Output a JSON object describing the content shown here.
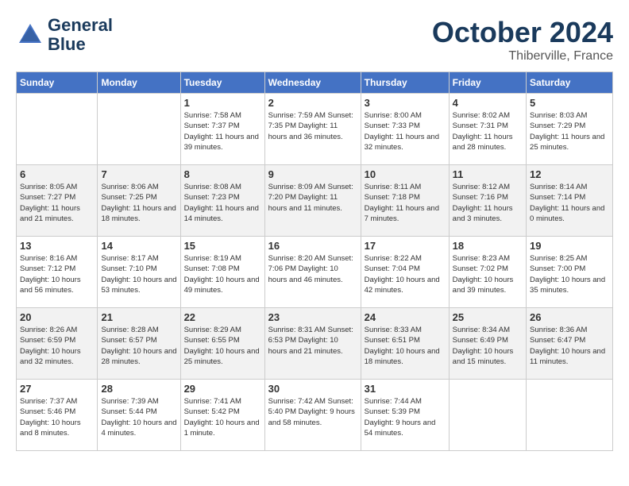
{
  "header": {
    "logo_line1": "General",
    "logo_line2": "Blue",
    "month": "October 2024",
    "location": "Thiberville, France"
  },
  "weekdays": [
    "Sunday",
    "Monday",
    "Tuesday",
    "Wednesday",
    "Thursday",
    "Friday",
    "Saturday"
  ],
  "weeks": [
    [
      {
        "day": "",
        "detail": ""
      },
      {
        "day": "",
        "detail": ""
      },
      {
        "day": "1",
        "detail": "Sunrise: 7:58 AM\nSunset: 7:37 PM\nDaylight: 11 hours\nand 39 minutes."
      },
      {
        "day": "2",
        "detail": "Sunrise: 7:59 AM\nSunset: 7:35 PM\nDaylight: 11 hours\nand 36 minutes."
      },
      {
        "day": "3",
        "detail": "Sunrise: 8:00 AM\nSunset: 7:33 PM\nDaylight: 11 hours\nand 32 minutes."
      },
      {
        "day": "4",
        "detail": "Sunrise: 8:02 AM\nSunset: 7:31 PM\nDaylight: 11 hours\nand 28 minutes."
      },
      {
        "day": "5",
        "detail": "Sunrise: 8:03 AM\nSunset: 7:29 PM\nDaylight: 11 hours\nand 25 minutes."
      }
    ],
    [
      {
        "day": "6",
        "detail": "Sunrise: 8:05 AM\nSunset: 7:27 PM\nDaylight: 11 hours\nand 21 minutes."
      },
      {
        "day": "7",
        "detail": "Sunrise: 8:06 AM\nSunset: 7:25 PM\nDaylight: 11 hours\nand 18 minutes."
      },
      {
        "day": "8",
        "detail": "Sunrise: 8:08 AM\nSunset: 7:23 PM\nDaylight: 11 hours\nand 14 minutes."
      },
      {
        "day": "9",
        "detail": "Sunrise: 8:09 AM\nSunset: 7:20 PM\nDaylight: 11 hours\nand 11 minutes."
      },
      {
        "day": "10",
        "detail": "Sunrise: 8:11 AM\nSunset: 7:18 PM\nDaylight: 11 hours\nand 7 minutes."
      },
      {
        "day": "11",
        "detail": "Sunrise: 8:12 AM\nSunset: 7:16 PM\nDaylight: 11 hours\nand 3 minutes."
      },
      {
        "day": "12",
        "detail": "Sunrise: 8:14 AM\nSunset: 7:14 PM\nDaylight: 11 hours\nand 0 minutes."
      }
    ],
    [
      {
        "day": "13",
        "detail": "Sunrise: 8:16 AM\nSunset: 7:12 PM\nDaylight: 10 hours\nand 56 minutes."
      },
      {
        "day": "14",
        "detail": "Sunrise: 8:17 AM\nSunset: 7:10 PM\nDaylight: 10 hours\nand 53 minutes."
      },
      {
        "day": "15",
        "detail": "Sunrise: 8:19 AM\nSunset: 7:08 PM\nDaylight: 10 hours\nand 49 minutes."
      },
      {
        "day": "16",
        "detail": "Sunrise: 8:20 AM\nSunset: 7:06 PM\nDaylight: 10 hours\nand 46 minutes."
      },
      {
        "day": "17",
        "detail": "Sunrise: 8:22 AM\nSunset: 7:04 PM\nDaylight: 10 hours\nand 42 minutes."
      },
      {
        "day": "18",
        "detail": "Sunrise: 8:23 AM\nSunset: 7:02 PM\nDaylight: 10 hours\nand 39 minutes."
      },
      {
        "day": "19",
        "detail": "Sunrise: 8:25 AM\nSunset: 7:00 PM\nDaylight: 10 hours\nand 35 minutes."
      }
    ],
    [
      {
        "day": "20",
        "detail": "Sunrise: 8:26 AM\nSunset: 6:59 PM\nDaylight: 10 hours\nand 32 minutes."
      },
      {
        "day": "21",
        "detail": "Sunrise: 8:28 AM\nSunset: 6:57 PM\nDaylight: 10 hours\nand 28 minutes."
      },
      {
        "day": "22",
        "detail": "Sunrise: 8:29 AM\nSunset: 6:55 PM\nDaylight: 10 hours\nand 25 minutes."
      },
      {
        "day": "23",
        "detail": "Sunrise: 8:31 AM\nSunset: 6:53 PM\nDaylight: 10 hours\nand 21 minutes."
      },
      {
        "day": "24",
        "detail": "Sunrise: 8:33 AM\nSunset: 6:51 PM\nDaylight: 10 hours\nand 18 minutes."
      },
      {
        "day": "25",
        "detail": "Sunrise: 8:34 AM\nSunset: 6:49 PM\nDaylight: 10 hours\nand 15 minutes."
      },
      {
        "day": "26",
        "detail": "Sunrise: 8:36 AM\nSunset: 6:47 PM\nDaylight: 10 hours\nand 11 minutes."
      }
    ],
    [
      {
        "day": "27",
        "detail": "Sunrise: 7:37 AM\nSunset: 5:46 PM\nDaylight: 10 hours\nand 8 minutes."
      },
      {
        "day": "28",
        "detail": "Sunrise: 7:39 AM\nSunset: 5:44 PM\nDaylight: 10 hours\nand 4 minutes."
      },
      {
        "day": "29",
        "detail": "Sunrise: 7:41 AM\nSunset: 5:42 PM\nDaylight: 10 hours\nand 1 minute."
      },
      {
        "day": "30",
        "detail": "Sunrise: 7:42 AM\nSunset: 5:40 PM\nDaylight: 9 hours\nand 58 minutes."
      },
      {
        "day": "31",
        "detail": "Sunrise: 7:44 AM\nSunset: 5:39 PM\nDaylight: 9 hours\nand 54 minutes."
      },
      {
        "day": "",
        "detail": ""
      },
      {
        "day": "",
        "detail": ""
      }
    ]
  ]
}
